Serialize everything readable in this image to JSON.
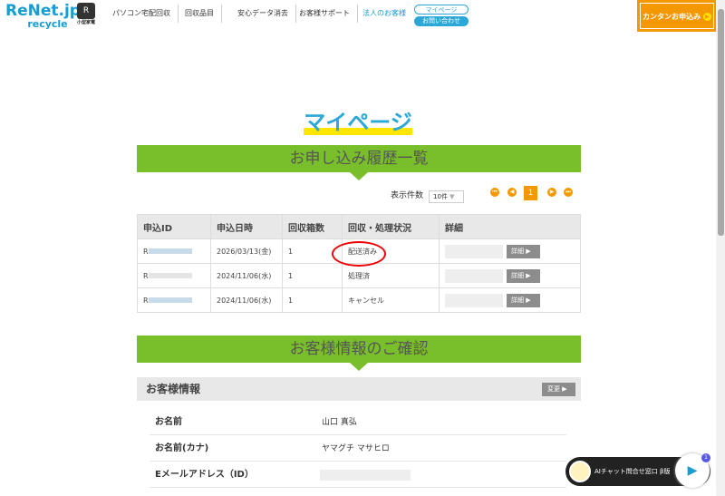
{
  "header": {
    "logo": "ReNet.jp",
    "logo_sub": "recycle",
    "badge": "小型家電",
    "nav": [
      "パソコン宅配回収",
      "回収品目",
      "安心データ消去",
      "お客様サポート",
      "法人のお客様"
    ],
    "mypage": "マイページ",
    "contact": "お問い合わせ",
    "cta": "カンタンお申込み"
  },
  "page_title": "マイページ",
  "history": {
    "banner": "お申し込み履歴一覧",
    "per_page_label": "表示件数",
    "per_page": "10件",
    "page": "1",
    "columns": [
      "申込ID",
      "申込日時",
      "回収箱数",
      "回収・処理状況",
      "詳細"
    ],
    "rows": [
      {
        "id": "R",
        "date": "2026/03/13(金)",
        "boxes": "1",
        "status": "配送済み"
      },
      {
        "id": "R",
        "date": "2024/11/06(水)",
        "boxes": "1",
        "status": "処理済"
      },
      {
        "id": "R",
        "date": "2024/11/06(水)",
        "boxes": "1",
        "status": "キャンセル"
      }
    ],
    "detail": "詳細"
  },
  "customer": {
    "banner": "お客様情報のご確認",
    "section": "お客様情報",
    "change": "変更",
    "fields": [
      {
        "label": "お名前",
        "value": "山口 真弘"
      },
      {
        "label": "お名前(カナ)",
        "value": "ヤマグチ マサヒロ"
      },
      {
        "label": "Eメールアドレス（ID）",
        "value": ""
      }
    ]
  },
  "chat": {
    "label": "AIチャット問合せ窓口 β版",
    "count": "1"
  },
  "colors": {
    "green": "#79bf2c",
    "orange": "#f39800",
    "blue": "#2ba8d8"
  }
}
